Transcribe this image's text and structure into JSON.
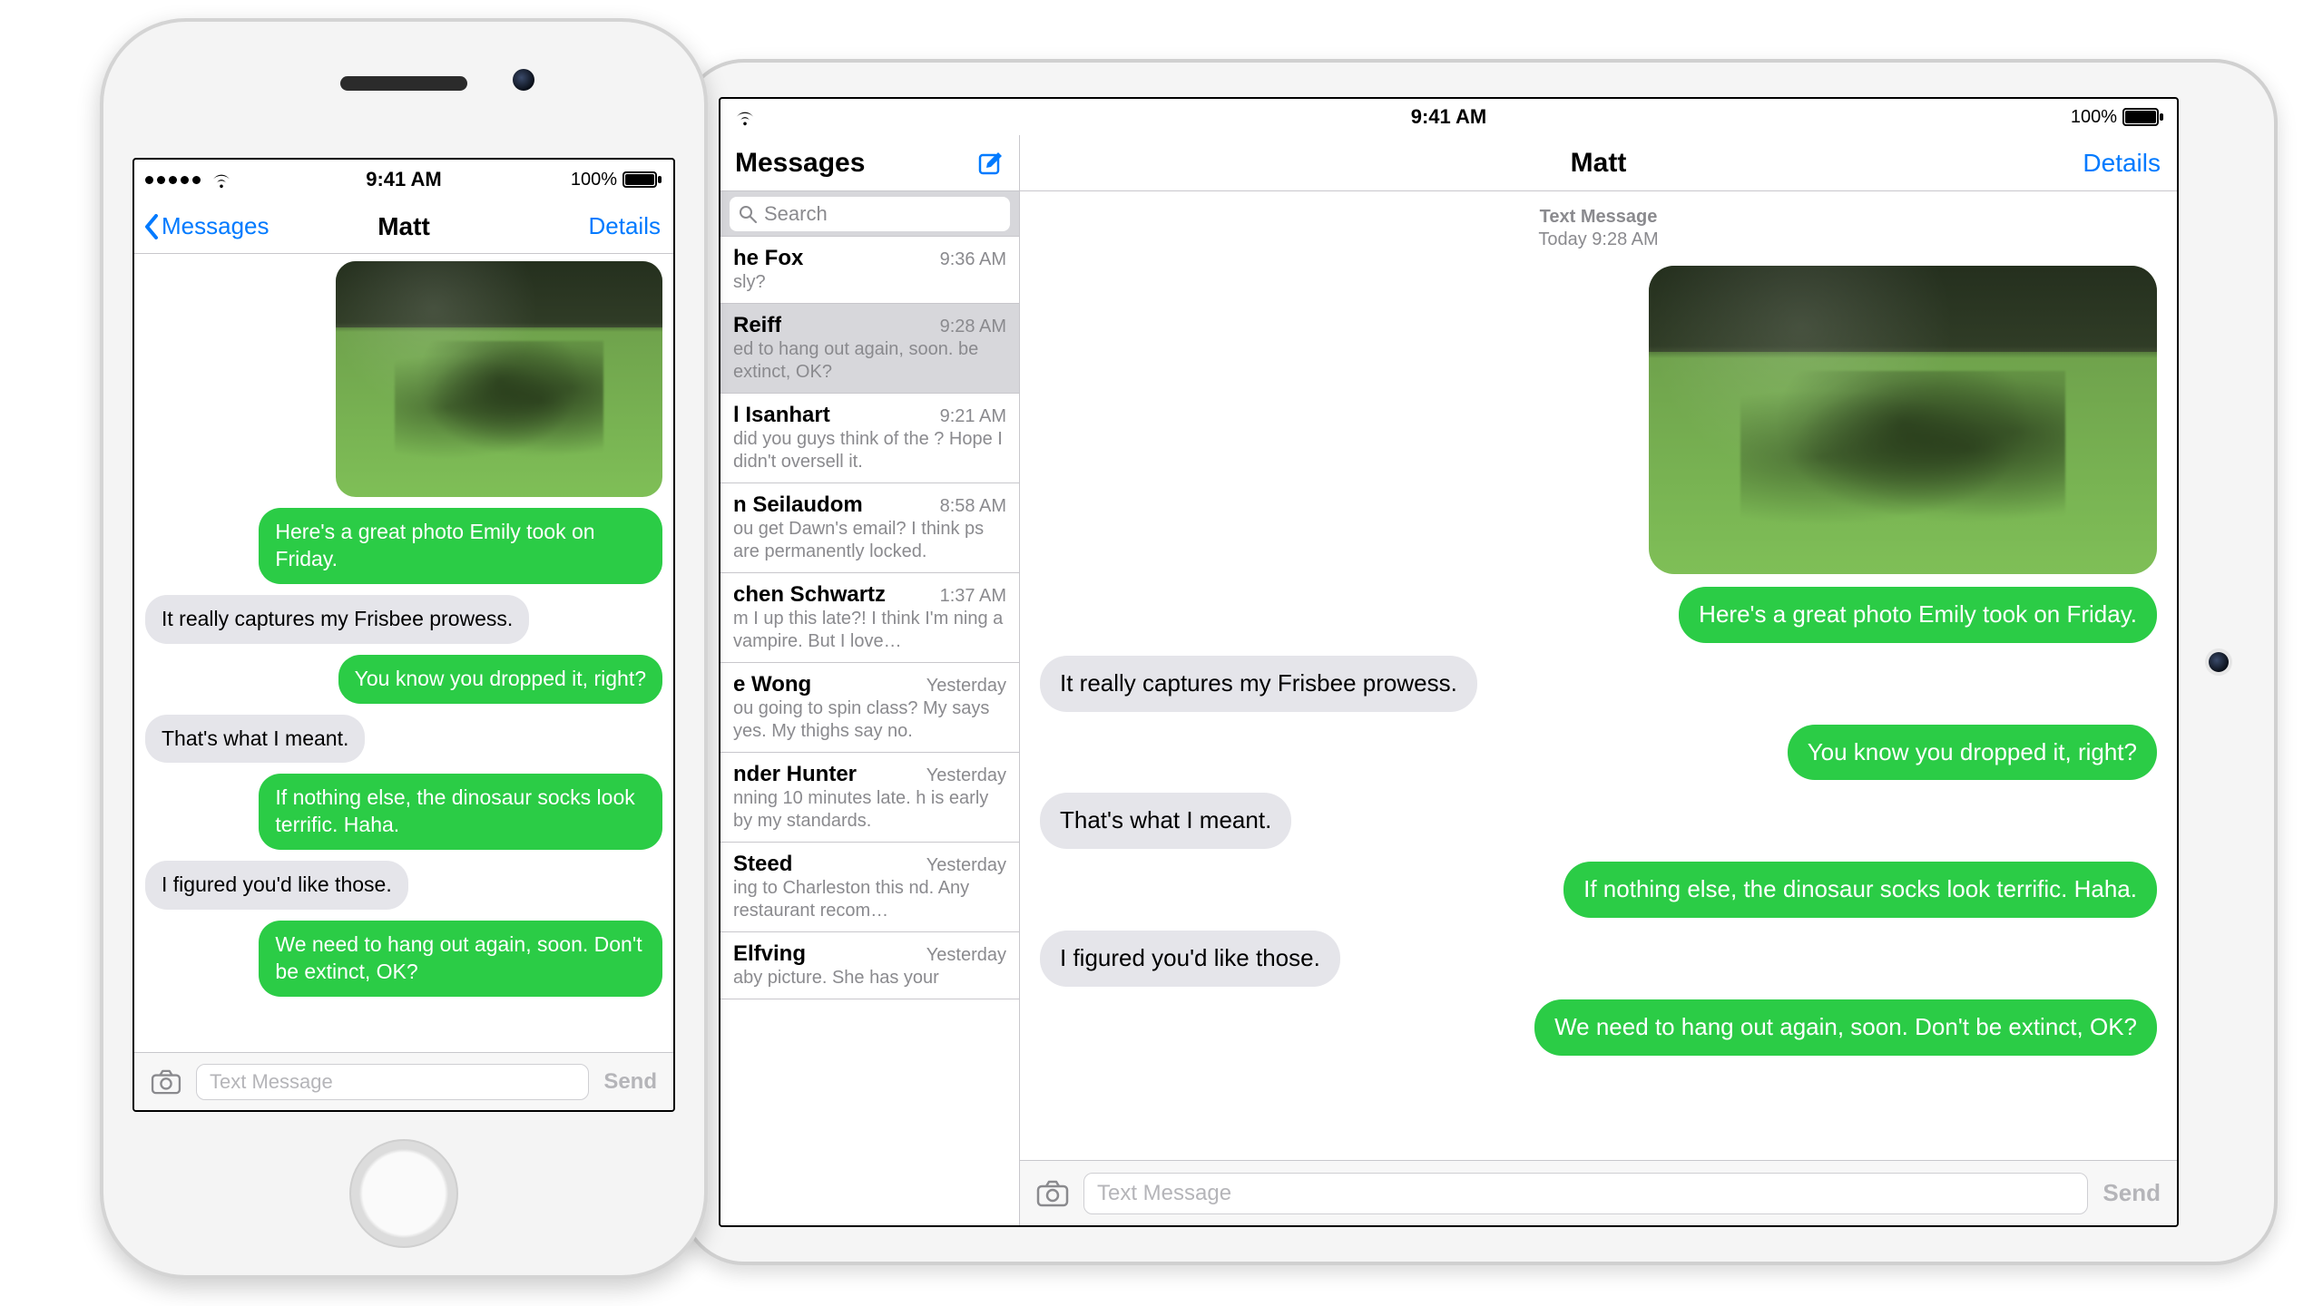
{
  "colors": {
    "accent_blue": "#007aff",
    "sms_green": "#2bcc46",
    "bubble_grey": "#e5e5ea"
  },
  "status": {
    "time": "9:41 AM",
    "battery_percent": "100%"
  },
  "contact_name": "Matt",
  "nav": {
    "back_label": "Messages",
    "details_label": "Details",
    "sidebar_title": "Messages",
    "search_placeholder": "Search"
  },
  "timestamp": {
    "type_label": "Text Message",
    "when": "Today 9:28 AM"
  },
  "composer": {
    "placeholder": "Text Message",
    "send_label": "Send"
  },
  "messages": [
    {
      "from": "me",
      "kind": "photo"
    },
    {
      "from": "me",
      "kind": "text",
      "text": "Here's a great photo Emily took on Friday."
    },
    {
      "from": "them",
      "kind": "text",
      "text": "It really captures my Frisbee prowess."
    },
    {
      "from": "me",
      "kind": "text",
      "text": "You know you dropped it, right?"
    },
    {
      "from": "them",
      "kind": "text",
      "text": "That's what I meant."
    },
    {
      "from": "me",
      "kind": "text",
      "text": "If nothing else, the dinosaur socks look terrific. Haha."
    },
    {
      "from": "them",
      "kind": "text",
      "text": "I figured you'd like those."
    },
    {
      "from": "me",
      "kind": "text",
      "text": "We need to hang out again, soon. Don't be extinct, OK?"
    }
  ],
  "conversations": [
    {
      "name": "he Fox",
      "time": "9:36 AM",
      "preview": "sly?",
      "selected": false
    },
    {
      "name": "Reiff",
      "time": "9:28 AM",
      "preview": "ed to hang out again, soon. be extinct, OK?",
      "selected": true
    },
    {
      "name": "l Isanhart",
      "time": "9:21 AM",
      "preview": "did you guys think of the ? Hope I didn't oversell it.",
      "selected": false
    },
    {
      "name": "n Seilaudom",
      "time": "8:58 AM",
      "preview": "ou get Dawn's email? I think ps are permanently locked.",
      "selected": false
    },
    {
      "name": "chen Schwartz",
      "time": "1:37 AM",
      "preview": "m I up this late?! I think I'm ning a vampire. But I love…",
      "selected": false
    },
    {
      "name": "e Wong",
      "time": "Yesterday",
      "preview": "ou going to spin class? My says yes. My thighs say no.",
      "selected": false
    },
    {
      "name": "nder Hunter",
      "time": "Yesterday",
      "preview": "nning 10 minutes late. h is early by my standards.",
      "selected": false
    },
    {
      "name": "Steed",
      "time": "Yesterday",
      "preview": "ing to Charleston this nd. Any restaurant recom…",
      "selected": false
    },
    {
      "name": "Elfving",
      "time": "Yesterday",
      "preview": "aby picture. She has your",
      "selected": false
    }
  ]
}
